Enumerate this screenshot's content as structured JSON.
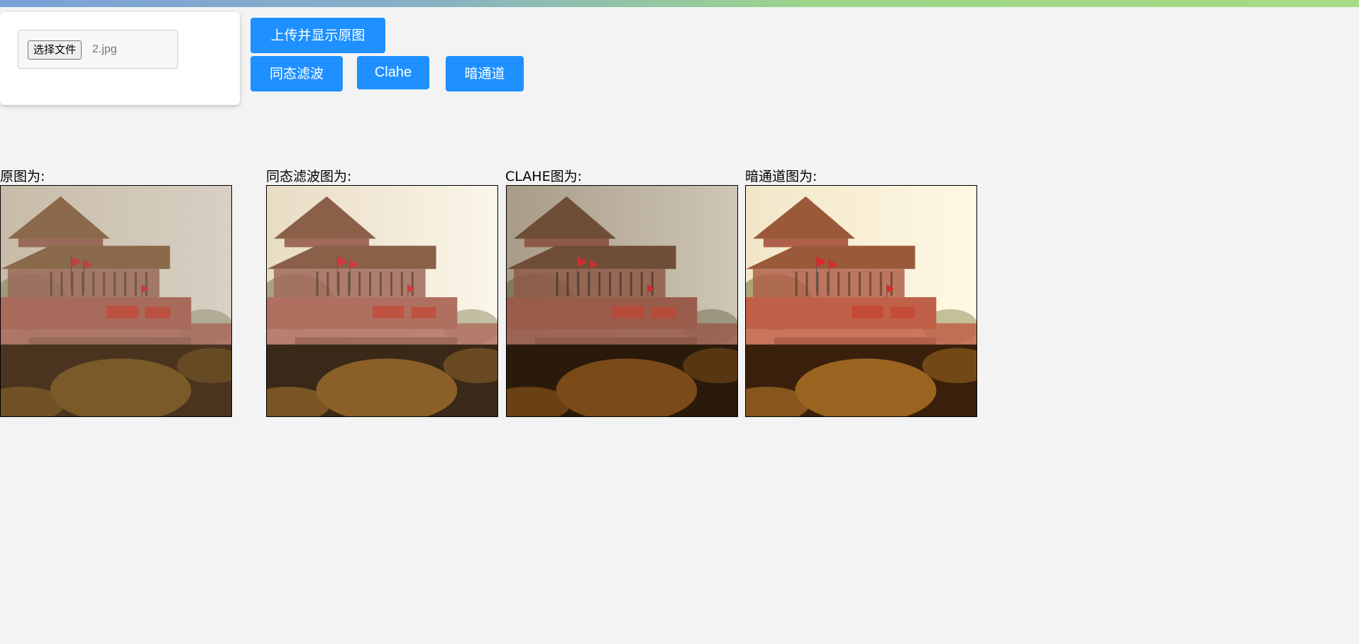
{
  "header": {
    "accent_gradient": [
      "#7aa1d8",
      "#a6dc84"
    ]
  },
  "upload": {
    "choose_file_label": "选择文件",
    "file_name": "2.jpg"
  },
  "buttons": {
    "upload_show": "上传并显示原图",
    "homomorphic": "同态滤波",
    "clahe": "Clahe",
    "dark_channel": "暗通道",
    "color": "#1e90ff"
  },
  "results": [
    {
      "label": "原图为:",
      "image_icon": "tiananmen-gate-image",
      "variant": "hazy"
    },
    {
      "label": "同态滤波图为:",
      "image_icon": "tiananmen-gate-image",
      "variant": "bright"
    },
    {
      "label": "CLAHE图为:",
      "image_icon": "tiananmen-gate-image",
      "variant": "contrast"
    },
    {
      "label": "暗通道图为:",
      "image_icon": "tiananmen-gate-image",
      "variant": "dehazed"
    }
  ]
}
